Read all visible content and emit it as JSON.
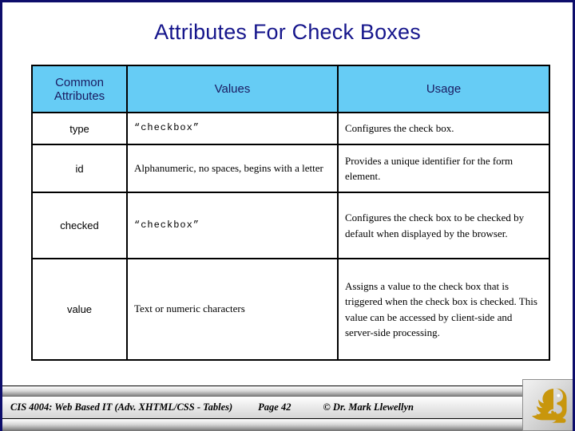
{
  "slide": {
    "title": "Attributes For Check Boxes",
    "border_color": "#0d0d6b",
    "title_color": "#16168c"
  },
  "table": {
    "header_bg": "#66ccf5",
    "header_text_color": "#1a1a60",
    "columns": [
      {
        "id": "common-attributes",
        "label": "Common\nAttributes",
        "label_line1": "Common",
        "label_line2": "Attributes"
      },
      {
        "id": "values",
        "label": "Values"
      },
      {
        "id": "usage",
        "label": "Usage"
      }
    ],
    "rows": [
      {
        "attribute": "type",
        "values": "“checkbox”",
        "usage": "Configures the check box."
      },
      {
        "attribute": "id",
        "values": "Alphanumeric, no spaces, begins with a letter",
        "usage": "Provides a unique identifier for the form element."
      },
      {
        "attribute": "checked",
        "values": "“checkbox”",
        "usage": "Configures the check box to be checked by default when displayed by the browser."
      },
      {
        "attribute": "value",
        "values": "Text or numeric characters",
        "usage": "Assigns a  value to the check box that is triggered when the check box is checked.  This value can be accessed by client-side and server-side processing."
      }
    ]
  },
  "footer": {
    "course": "CIS 4004: Web Based IT (Adv. XHTML/CSS - Tables)",
    "page": "Page 42",
    "copyright": "© Dr. Mark Llewellyn",
    "logo_name": "pegasus-logo-icon",
    "logo_color": "#c8960c"
  }
}
